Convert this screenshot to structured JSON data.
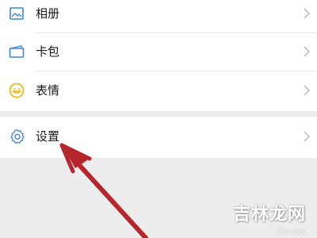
{
  "menu": {
    "items": [
      {
        "label": "相册",
        "icon": "album-icon"
      },
      {
        "label": "卡包",
        "icon": "card-wallet-icon"
      },
      {
        "label": "表情",
        "icon": "emoji-icon"
      }
    ],
    "settings": {
      "label": "设置",
      "icon": "gear-icon"
    }
  },
  "colors": {
    "icon_blue": "#3d87d6",
    "icon_yellow": "#f0b400",
    "arrow_red": "#b5272d",
    "background": "#ededed"
  },
  "watermark": {
    "main": "吉林龙网",
    "sub": "jlhz.net"
  }
}
